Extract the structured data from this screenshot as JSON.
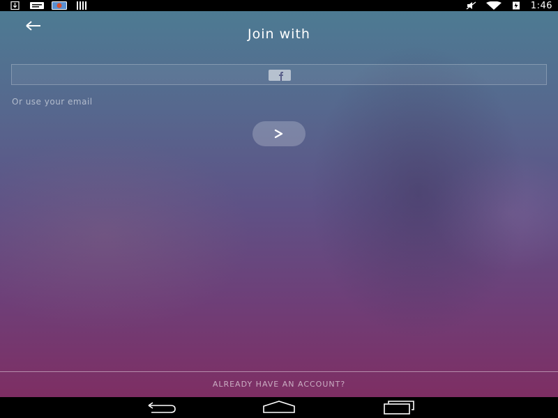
{
  "status_bar": {
    "time": "1:46",
    "icons_left": [
      "download-icon",
      "message-icon",
      "photo-icon",
      "barcode-icon"
    ],
    "icons_right": [
      "mute-icon",
      "wifi-icon",
      "battery-icon"
    ]
  },
  "header": {
    "title": "Join with",
    "back_icon": "arrow-left-icon"
  },
  "facebook_button": {
    "icon": "facebook-icon"
  },
  "email_section": {
    "label": "Or use your email",
    "next_icon": "chevron-right-icon"
  },
  "footer": {
    "login_link": "ALREADY HAVE AN ACCOUNT?"
  },
  "nav_bar": {
    "buttons": [
      "back-nav",
      "home-nav",
      "recents-nav"
    ]
  },
  "colors": {
    "gradient_top": "#4d7b93",
    "gradient_mid": "#5e5286",
    "gradient_bottom": "#7e2e63",
    "status_bar_bg": "#000000",
    "text": "#ffffff"
  }
}
